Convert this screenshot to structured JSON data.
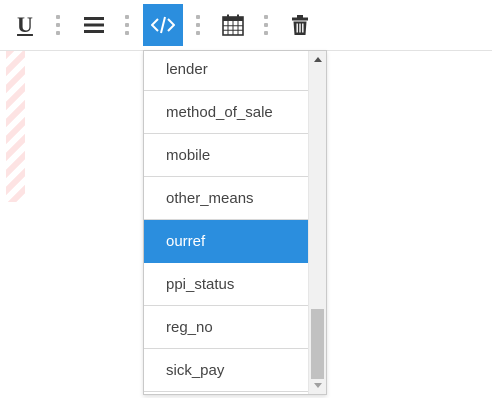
{
  "toolbar": {
    "buttons": [
      {
        "name": "underline-button",
        "icon": "underline-icon",
        "glyph": "U"
      },
      {
        "name": "align-button",
        "icon": "align-justify-icon"
      },
      {
        "name": "code-button",
        "icon": "code-icon",
        "active": true
      },
      {
        "name": "calendar-button",
        "icon": "calendar-icon"
      },
      {
        "name": "delete-button",
        "icon": "trash-icon"
      }
    ],
    "active_color": "#2b8ede"
  },
  "dropdown": {
    "items": [
      {
        "label": "lender"
      },
      {
        "label": "method_of_sale"
      },
      {
        "label": "mobile"
      },
      {
        "label": "other_means"
      },
      {
        "label": "ourref",
        "selected": true
      },
      {
        "label": "ppi_status"
      },
      {
        "label": "reg_no"
      },
      {
        "label": "sick_pay"
      }
    ],
    "selected_color": "#2b8ede",
    "scroll_position": 0.9
  }
}
